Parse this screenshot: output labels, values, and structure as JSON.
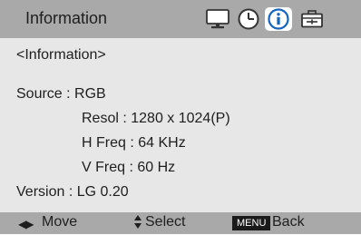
{
  "header": {
    "title": "Information",
    "tabs": [
      {
        "icon": "monitor-icon",
        "active": false
      },
      {
        "icon": "clock-icon",
        "active": false
      },
      {
        "icon": "info-icon",
        "active": true
      },
      {
        "icon": "toolbox-icon",
        "active": false
      }
    ]
  },
  "content": {
    "section_title": "<Information>",
    "source": "Source : RGB",
    "resolution": "Resol : 1280 x 1024(P)",
    "h_freq": "H Freq : 64 KHz",
    "v_freq": "V Freq : 60 Hz",
    "version": "Version : LG 0.20"
  },
  "footer": {
    "move_label": "Move",
    "select_label": "Select",
    "menu_badge": "MENU",
    "back_label": "Back"
  },
  "colors": {
    "bar": "#a9a9a9",
    "panel": "#e7e7e7",
    "accent": "#1565c0",
    "text": "#1e1e1e"
  }
}
